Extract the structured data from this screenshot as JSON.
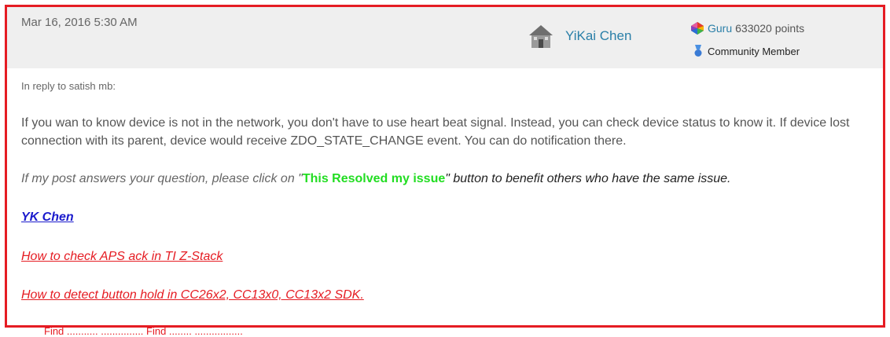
{
  "post": {
    "date": "Mar 16, 2016 5:30 AM",
    "author": {
      "name": "YiKai Chen",
      "avatar_icon": "avatar-icon"
    },
    "rank": {
      "icon": "guru-gem-icon",
      "label": "Guru",
      "points": "633020 points"
    },
    "badge": {
      "icon": "medal-icon",
      "label": "Community Member"
    },
    "reply_to": "In reply to satish mb:",
    "body": "If you wan to know device is not in the network, you don't have to use heart beat signal. Instead, you can check device status to know it. If device lost connection with its parent, device would receive ZDO_STATE_CHANGE event. You can do notification there."
  },
  "signature": {
    "line1_pre": "If my post answers your question, please click on \"",
    "line1_button": "This Resolved my issue",
    "line1_post": "\" button to benefit others who have the same issue.",
    "name_link": "YK Chen",
    "link1": "How to check APS ack in TI Z-Stack",
    "link2": "How to detect button hold in CC26x2, CC13x0, CC13x2 SDK."
  },
  "below_fragment": "Find ........... ............... Find ........ ................."
}
